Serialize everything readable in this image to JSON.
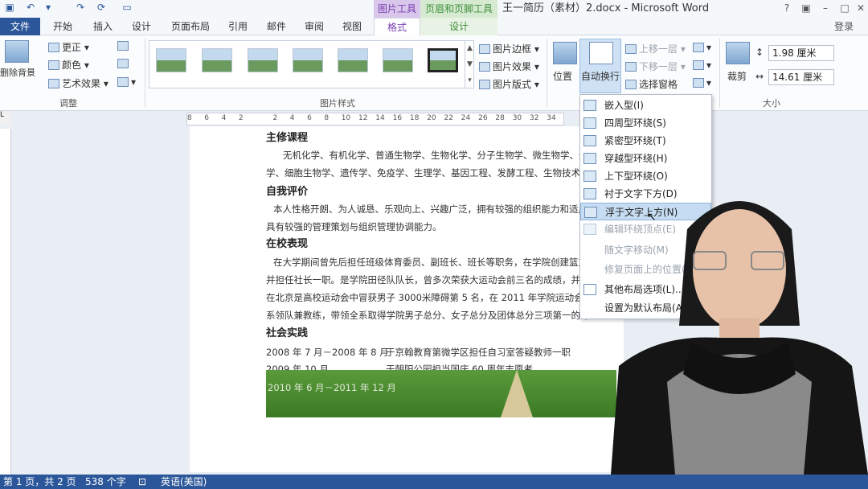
{
  "window": {
    "title": "王一简历（素材）2.docx - Microsoft Word",
    "context_groups": [
      "图片工具",
      "页眉和页脚工具"
    ],
    "login": "登录"
  },
  "tabs": [
    "文件",
    "开始",
    "插入",
    "设计",
    "页面布局",
    "引用",
    "邮件",
    "审阅",
    "视图",
    "格式",
    "设计"
  ],
  "ribbon": {
    "adjust": {
      "remove_bg": "删除背景",
      "correct": "更正",
      "color": "颜色",
      "artistic": "艺术效果",
      "label": "调整"
    },
    "styles": {
      "label": "图片样式",
      "border": "图片边框",
      "effects": "图片效果",
      "layout": "图片版式"
    },
    "arrange": {
      "position": "位置",
      "wrap": "自动换行",
      "forward": "上移一层",
      "backward": "下移一层",
      "selection_pane": "选择窗格"
    },
    "size": {
      "crop": "裁剪",
      "height": "1.98 厘米",
      "width": "14.61 厘米",
      "label": "大小"
    }
  },
  "ruler_marks": [
    "8",
    "6",
    "4",
    "2",
    "",
    "2",
    "4",
    "6",
    "8",
    "10",
    "12",
    "14",
    "16",
    "18",
    "20",
    "22",
    "24",
    "26",
    "28",
    "30",
    "32",
    "34"
  ],
  "document": {
    "h1": "主修课程",
    "p1a": "无机化学、有机化学、普通生物学、生物化学、分子生物学、微生物学、蛋白",
    "p1b": "学、细胞生物学、遗传学、免疫学、生理学、基因工程、发酵工程、生物技术制",
    "h2": "自我评价",
    "p2a": "本人性格开朗、为人诚恳、乐观向上、兴趣广泛，拥有较强的组织能力和适应",
    "p2b": "具有较强的管理策划与组织管理协调能力。",
    "h3": "在校表现",
    "p3a": "在大学期间曾先后担任班级体育委员、副班长、班长等职务，在学院创建篮方",
    "p3b": "并担任社长一职。是学院田径队队长，曾多次荣获大运动会前三名的成绩，并",
    "p3c": "在北京是高校运动会中冒获男子 3000米障碍第 5 名，在 2011 年学院运动会中",
    "p3d": "系领队兼教练，带领全系取得学院男子总分、女子总分及团体总分三项第一的好",
    "h4": "社会实践",
    "r1_date": "2008 年 7 月－2008 年 8 月",
    "r1_text": "于京翰教育第微学区担任自习室答疑教师一职",
    "r2_date": "2009 年 10 月",
    "r2_text": "于朝阳公园担当国庆 60 周年志愿者",
    "r3_date": "2010 年 6 月－2011 年 12 月"
  },
  "wrap_menu": [
    {
      "label": "嵌入型(I)",
      "state": "normal"
    },
    {
      "label": "四周型环绕(S)",
      "state": "normal"
    },
    {
      "label": "紧密型环绕(T)",
      "state": "normal"
    },
    {
      "label": "穿越型环绕(H)",
      "state": "normal"
    },
    {
      "label": "上下型环绕(O)",
      "state": "normal"
    },
    {
      "label": "衬于文字下方(D)",
      "state": "normal"
    },
    {
      "label": "浮于文字上方(N)",
      "state": "highlighted"
    },
    {
      "label": "编辑环绕顶点(E)",
      "state": "disabled"
    },
    {
      "label": "随文字移动(M)",
      "state": "disabled"
    },
    {
      "label": "修复页面上的位置(",
      "state": "disabled"
    },
    {
      "label": "其他布局选项(L)...",
      "state": "normal"
    },
    {
      "label": "设置为默认布局(A)",
      "state": "normal"
    }
  ],
  "status": {
    "pages": "第 1 页，共 2 页",
    "words": "538 个字",
    "language": "英语(美国)"
  },
  "colors": {
    "accent": "#2b579a",
    "picture_tools": "#7a3fb0",
    "header_tools": "#3f8f3a",
    "menu_highlight": "#c5dcf2"
  }
}
